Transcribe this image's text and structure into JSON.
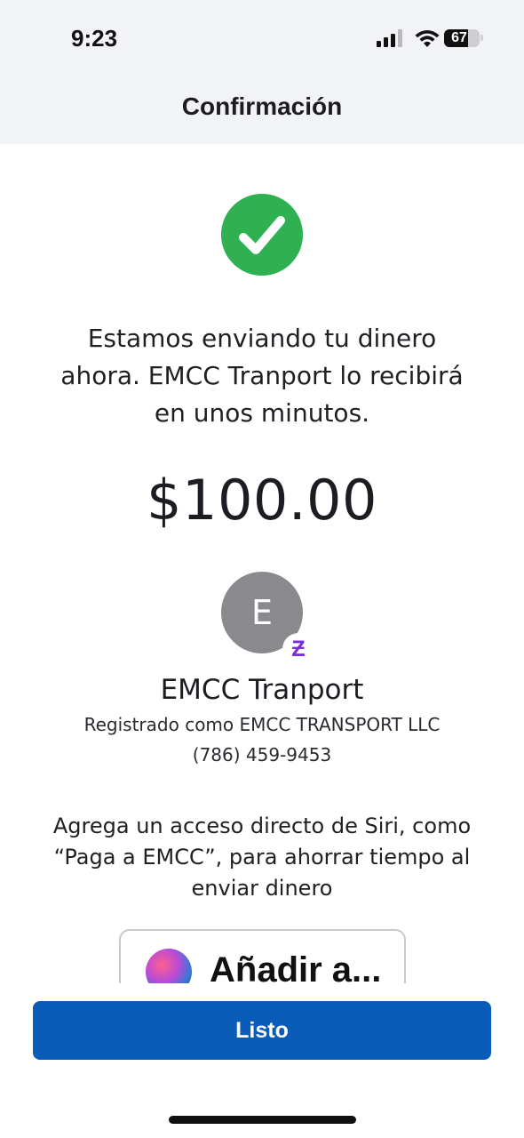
{
  "status_bar": {
    "time": "9:23",
    "battery_level": "67",
    "icons": [
      "signal-icon",
      "wifi-icon",
      "battery-icon"
    ]
  },
  "header": {
    "title": "Confirmación"
  },
  "confirmation": {
    "icon": "checkmark-circle-icon",
    "message": "Estamos enviando tu dinero ahora. EMCC Tranport  lo recibirá en unos minutos.",
    "amount": "$100.00"
  },
  "recipient": {
    "avatar_initial": "E",
    "badge_glyph": "Ƶ",
    "name": "EMCC Tranport",
    "registered_as": "Registrado como EMCC TRANSPORT LLC",
    "phone": "(786) 459-9453"
  },
  "siri": {
    "prompt": "Agrega un acceso directo de Siri, como “Paga a EMCC”, para ahorrar tiempo al enviar dinero",
    "button_label": "Añadir a..."
  },
  "actions": {
    "done_label": "Listo"
  },
  "colors": {
    "header_bg": "#f2f3f7",
    "success_green": "#2fb152",
    "primary_button": "#0b5cb8",
    "badge_purple": "#7b2cde",
    "avatar_gray": "#8a8a8e"
  }
}
